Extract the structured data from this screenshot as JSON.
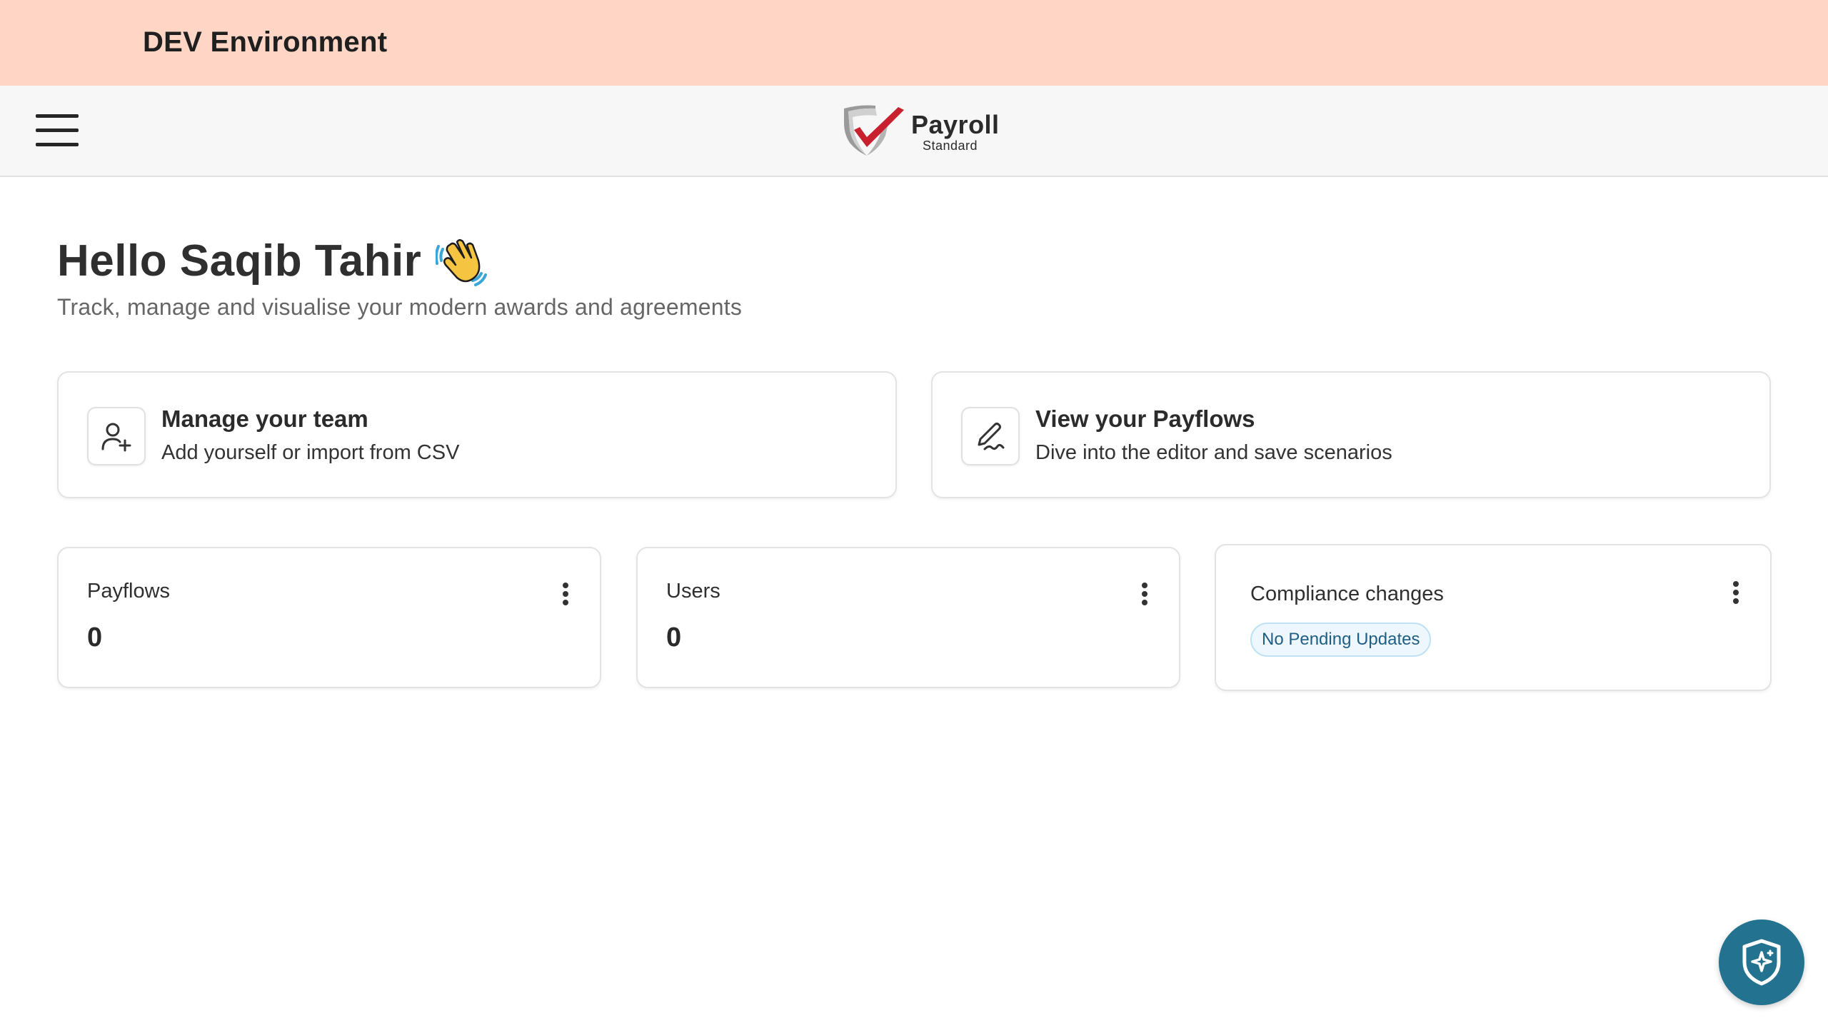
{
  "environment_banner": {
    "label": "DEV Environment",
    "color": "#ffd6c5"
  },
  "header": {
    "menu_icon": "hamburger-menu-icon",
    "logo": {
      "title": "Payroll",
      "subtitle": "Standard"
    }
  },
  "greeting": {
    "title": "Hello Saqib Tahir",
    "emoji_icon": "waving-hand-icon",
    "subtitle": "Track, manage and visualise your modern awards and agreements"
  },
  "actions": [
    {
      "icon": "user-plus-icon",
      "title": "Manage your team",
      "description": "Add yourself or import from CSV"
    },
    {
      "icon": "pen-signature-icon",
      "title": "View your Payflows",
      "description": "Dive into the editor and save scenarios"
    }
  ],
  "stats": [
    {
      "label": "Payflows",
      "value": "0",
      "menu_icon": "more-vertical-icon"
    },
    {
      "label": "Users",
      "value": "0",
      "menu_icon": "more-vertical-icon"
    },
    {
      "label": "Compliance changes",
      "badge": "No Pending Updates",
      "menu_icon": "more-vertical-icon"
    }
  ],
  "floating_button": {
    "icon": "shield-sparkle-icon",
    "color": "#23728f"
  }
}
